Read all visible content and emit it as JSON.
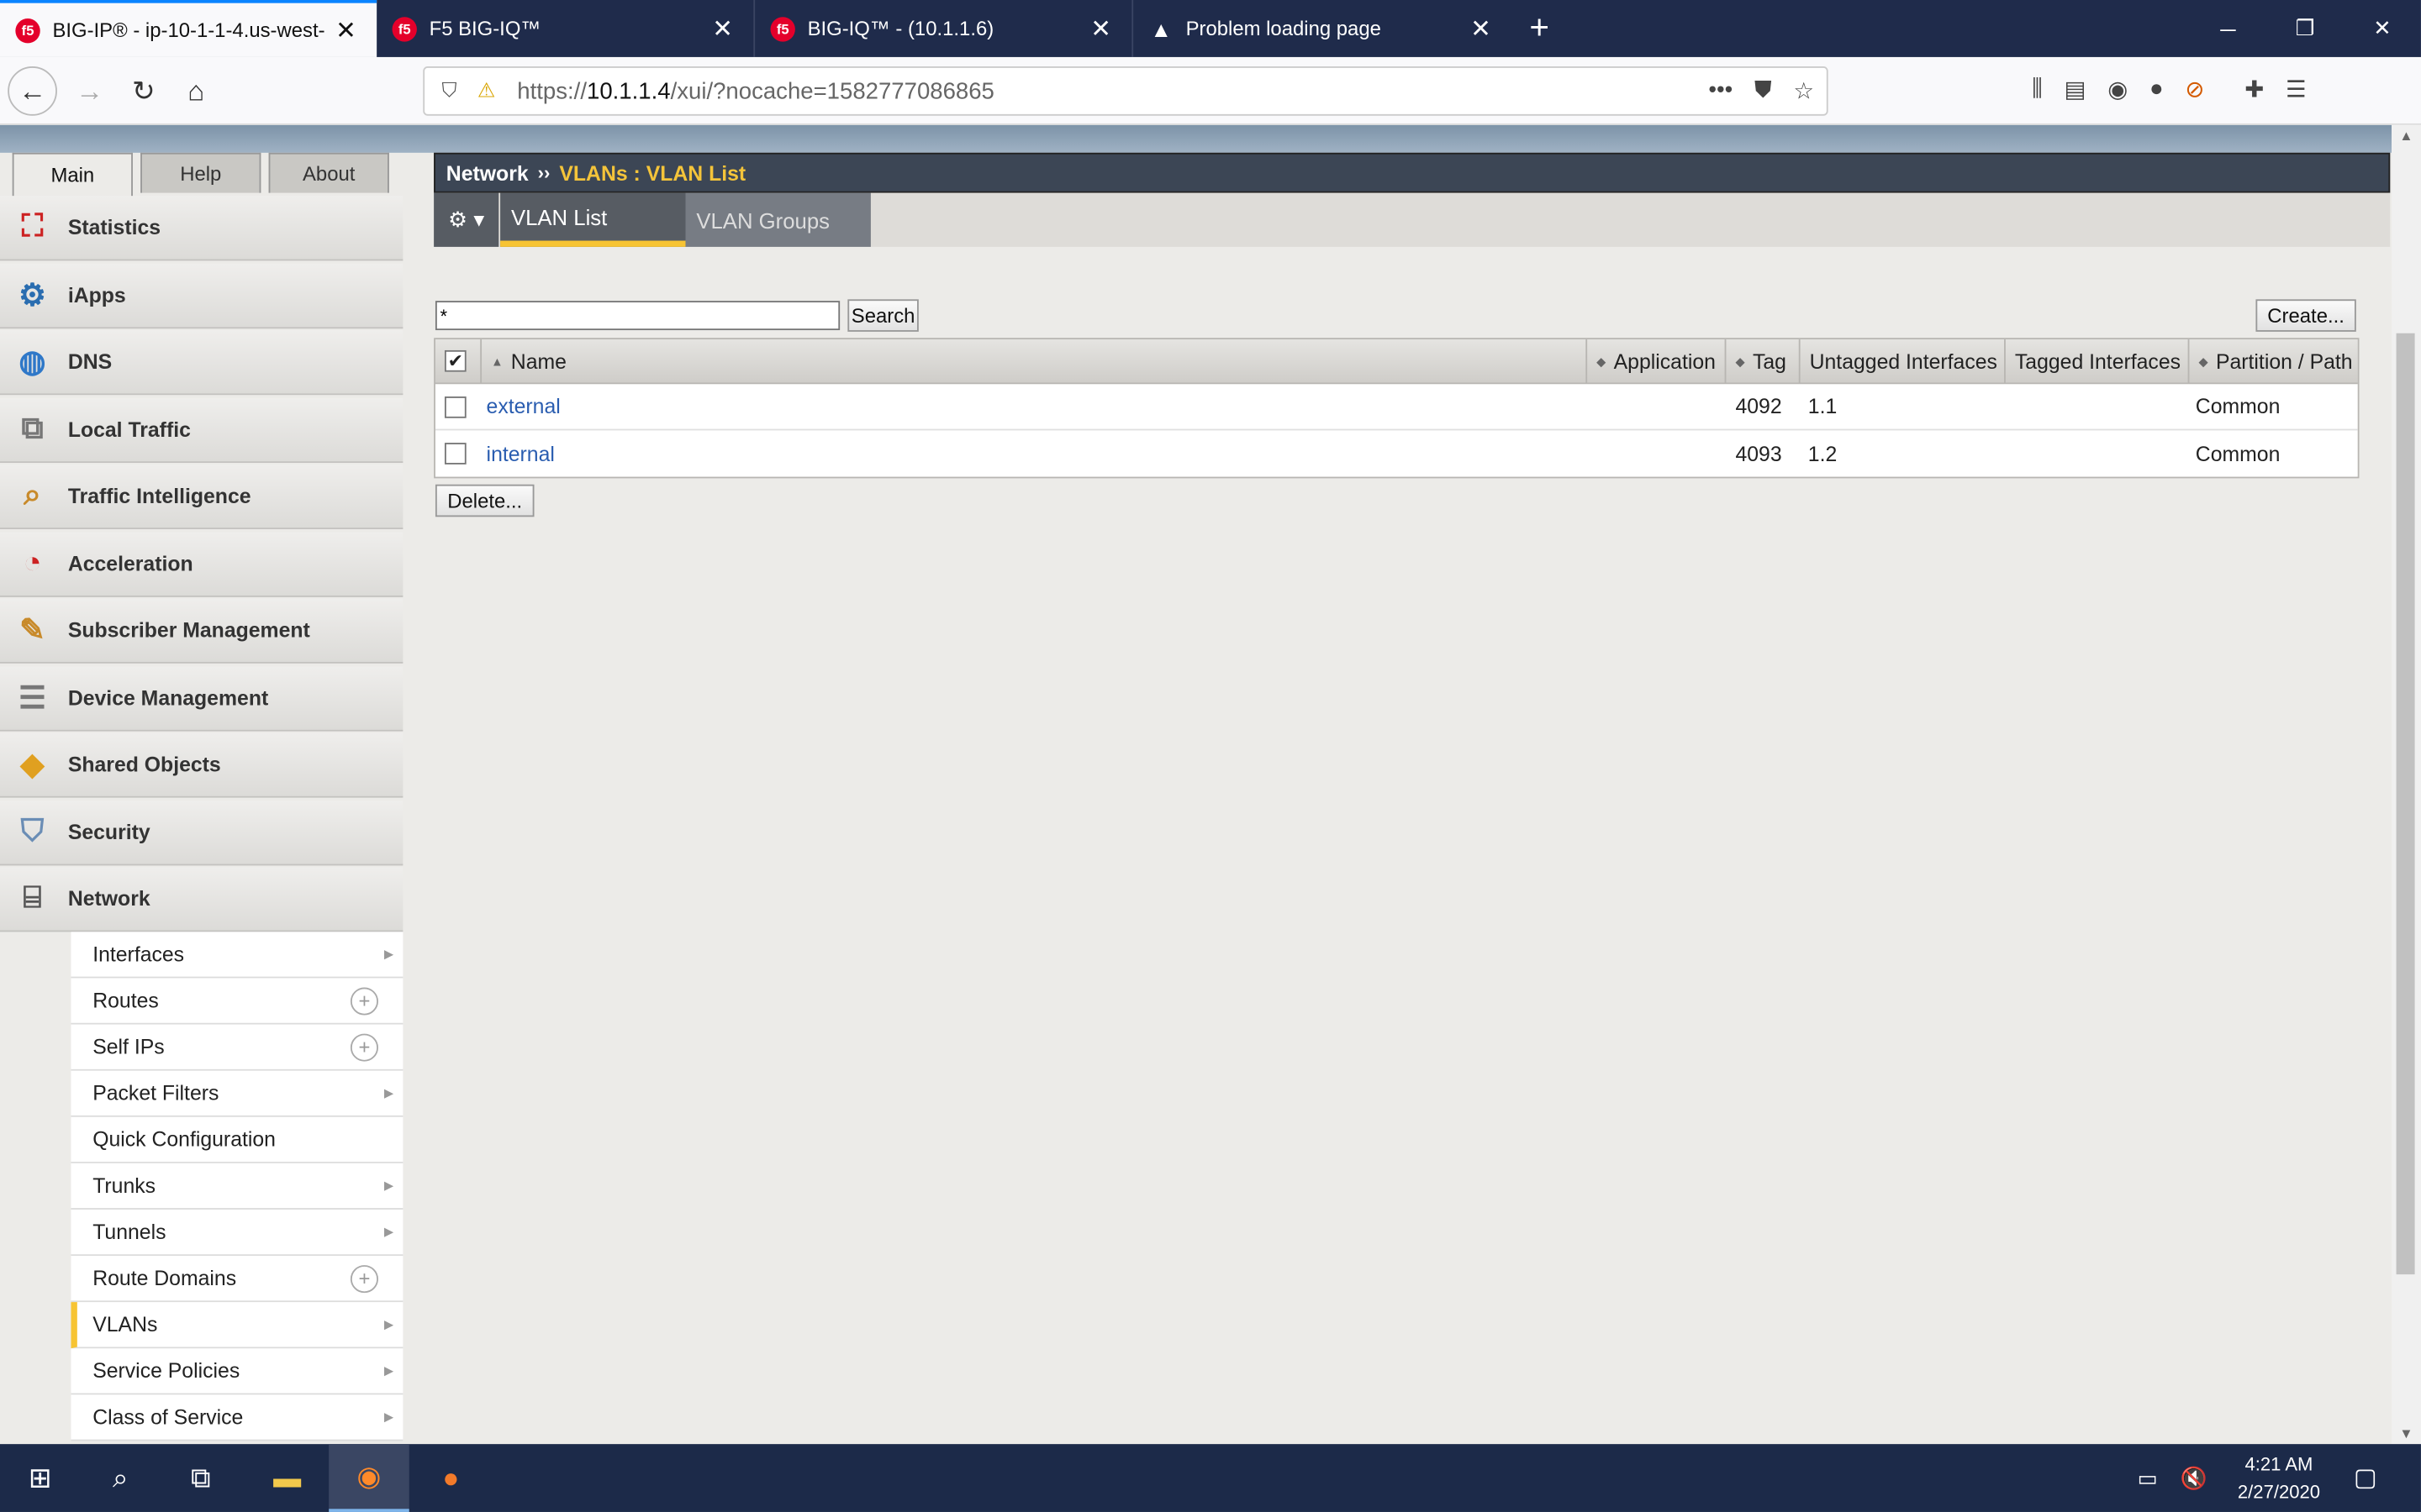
{
  "browser": {
    "tabs": [
      {
        "title": "BIG-IP® - ip-10-1-1-4.us-west-",
        "favicon": "f5-logo-icon",
        "active": true
      },
      {
        "title": "F5 BIG-IQ™",
        "favicon": "f5-logo-icon",
        "active": false
      },
      {
        "title": "BIG-IQ™ - (10.1.1.6)",
        "favicon": "f5-logo-icon",
        "active": false
      },
      {
        "title": "Problem loading page",
        "favicon": "warning-icon",
        "active": false
      }
    ],
    "url_prefix": "https://",
    "url_host": "10.1.1.4",
    "url_path": "/xui/?nocache=1582777086865"
  },
  "main_tabs": [
    {
      "label": "Main",
      "active": true
    },
    {
      "label": "Help",
      "active": false
    },
    {
      "label": "About",
      "active": false
    }
  ],
  "sidebar": {
    "items": [
      {
        "label": "Statistics",
        "icon": "statistics-icon"
      },
      {
        "label": "iApps",
        "icon": "iapps-icon"
      },
      {
        "label": "DNS",
        "icon": "dns-globe-icon"
      },
      {
        "label": "Local Traffic",
        "icon": "local-traffic-icon"
      },
      {
        "label": "Traffic Intelligence",
        "icon": "traffic-intelligence-icon"
      },
      {
        "label": "Acceleration",
        "icon": "acceleration-gauge-icon"
      },
      {
        "label": "Subscriber Management",
        "icon": "subscriber-management-icon"
      },
      {
        "label": "Device Management",
        "icon": "device-management-icon"
      },
      {
        "label": "Shared Objects",
        "icon": "shared-objects-icon"
      },
      {
        "label": "Security",
        "icon": "security-shield-icon"
      },
      {
        "label": "Network",
        "icon": "network-icon"
      }
    ],
    "network_subitems": [
      {
        "label": "Interfaces",
        "control": "arrow"
      },
      {
        "label": "Routes",
        "control": "plus"
      },
      {
        "label": "Self IPs",
        "control": "plus"
      },
      {
        "label": "Packet Filters",
        "control": "arrow"
      },
      {
        "label": "Quick Configuration",
        "control": "none"
      },
      {
        "label": "Trunks",
        "control": "arrow"
      },
      {
        "label": "Tunnels",
        "control": "arrow"
      },
      {
        "label": "Route Domains",
        "control": "plus"
      },
      {
        "label": "VLANs",
        "control": "arrow",
        "selected": true
      },
      {
        "label": "Service Policies",
        "control": "arrow"
      },
      {
        "label": "Class of Service",
        "control": "arrow"
      }
    ]
  },
  "breadcrumb": {
    "section": "Network",
    "separator": "››",
    "page": "VLANs : VLAN List"
  },
  "subtabs": [
    {
      "label": "VLAN List",
      "active": true
    },
    {
      "label": "VLAN Groups",
      "active": false
    }
  ],
  "search": {
    "value": "*",
    "button_label": "Search"
  },
  "create_button_label": "Create...",
  "delete_button_label": "Delete...",
  "table": {
    "columns": [
      "Name",
      "Application",
      "Tag",
      "Untagged Interfaces",
      "Tagged Interfaces",
      "Partition / Path"
    ],
    "rows": [
      {
        "name": "external",
        "application": "",
        "tag": "4092",
        "untagged": "1.1",
        "tagged": "",
        "partition": "Common"
      },
      {
        "name": "internal",
        "application": "",
        "tag": "4093",
        "untagged": "1.2",
        "tagged": "",
        "partition": "Common"
      }
    ]
  },
  "taskbar": {
    "time": "4:21 AM",
    "date": "2/27/2020"
  },
  "colors": {
    "accent_yellow": "#f7c433",
    "breadcrumb_bg": "#3c4655",
    "link_blue": "#2a5db0",
    "taskbar_bg": "#1c2a49"
  }
}
